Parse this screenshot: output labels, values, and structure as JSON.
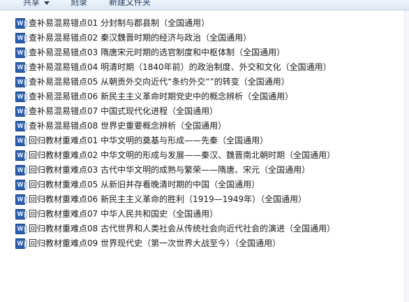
{
  "toolbar": {
    "share_label": "共享",
    "burn_label": "刻录",
    "new_folder_label": "新建文件夹"
  },
  "files": [
    {
      "icon": "word-document-icon",
      "glyph": "W",
      "name": "查补易混易错点01 分封制与郡县制（全国通用）"
    },
    {
      "icon": "word-document-icon",
      "glyph": "W",
      "name": "查补易混易错点02 秦汉魏晋时期的经济与政治（全国通用）"
    },
    {
      "icon": "word-document-icon",
      "glyph": "W",
      "name": "查补易混易错点03 隋唐宋元时期的选官制度和中枢体制（全国通用）"
    },
    {
      "icon": "word-document-icon",
      "glyph": "W",
      "name": "查补易混易错点04 明清时期（1840年前）的政治制度、外交和文化（全国通用）"
    },
    {
      "icon": "word-document-icon",
      "glyph": "W",
      "name": "查补易混易错点05 从朝贡外交向近代“条约外交“”的转变（全国通用）"
    },
    {
      "icon": "word-document-icon",
      "glyph": "W",
      "name": "查补易混易错点06 新民主主义革命时期党史中的概念辨析（全国通用）"
    },
    {
      "icon": "word-document-icon",
      "glyph": "W",
      "name": "查补易混易错点07 中国式现代化进程（全国通用）"
    },
    {
      "icon": "word-document-icon",
      "glyph": "W",
      "name": "查补易混易错点08 世界史重要概念辨析（全国通用）"
    },
    {
      "icon": "word-document-icon",
      "glyph": "W",
      "name": "回归教材重难点01 中华文明的奠基与形成——先秦（全国通用）"
    },
    {
      "icon": "word-document-icon",
      "glyph": "W",
      "name": "回归教材重难点02 中华文明的形成与发展——秦汉、魏晋南北朝时期（全国通用）"
    },
    {
      "icon": "word-document-icon",
      "glyph": "W",
      "name": "回归教材重难点03 古代中华文明的成熟与繁荣——隋唐、宋元（全国通用）"
    },
    {
      "icon": "word-document-icon",
      "glyph": "W",
      "name": "回归教材重难点05 从新旧并存看晚清时期的中国（全国通用）"
    },
    {
      "icon": "word-document-icon",
      "glyph": "W",
      "name": "回归教材重难点06 新民主主义革命的胜利（1919—1949年）（全国通用）"
    },
    {
      "icon": "word-document-icon",
      "glyph": "W",
      "name": "回归教材重难点07 中华人民共和国史（全国通用）"
    },
    {
      "icon": "word-document-icon",
      "glyph": "W",
      "name": "回归教材重难点08 古代世界和人类社会从传统社会向近代社会的演进（全国通用）"
    },
    {
      "icon": "word-document-icon",
      "glyph": "W",
      "name": "回归教材重难点09 世界现代史（第一次世界大战至今）（全国通用）"
    }
  ]
}
